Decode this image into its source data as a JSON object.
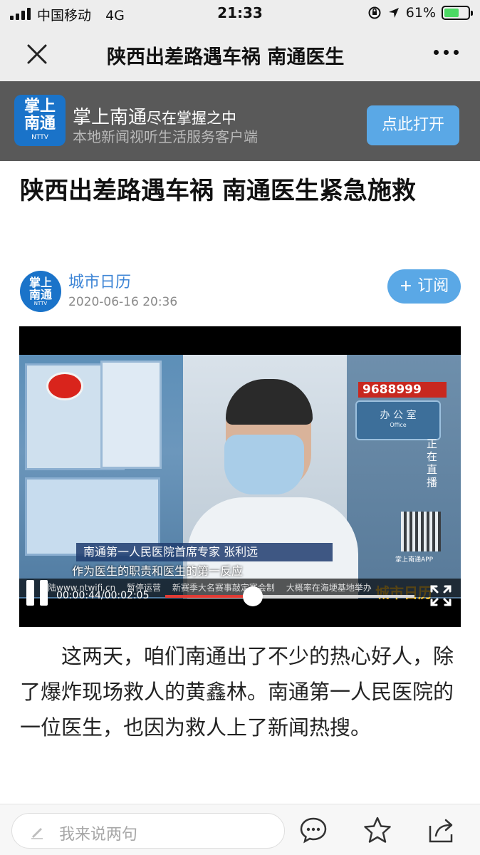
{
  "status_bar": {
    "carrier": "中国移动",
    "network": "4G",
    "time": "21:33",
    "battery_percent": "61%",
    "battery_level": 0.61
  },
  "nav": {
    "title": "陕西出差路遇车祸 南通医生"
  },
  "app_banner": {
    "logo_line1": "掌上",
    "logo_line2": "南通",
    "logo_mark": "NTTV",
    "name": "掌上南通",
    "slogan": "尽在掌握之中",
    "subtitle": "本地新闻视听生活服务客户端",
    "open_button": "点此打开"
  },
  "article": {
    "title": "陕西出差路遇车祸 南通医生紧急施救",
    "author": {
      "avatar_line1": "掌上",
      "avatar_line2": "南通",
      "avatar_mark": "NTTV",
      "name": "城市日历",
      "date": "2020-06-16 20:36"
    },
    "subscribe_button": "+ 订阅",
    "body": "这两天，咱们南通出了不少的热心好人，除了爆炸现场救人的黄鑫林。南通第一人民医院的一位医生，也因为救人上了新闻热搜。"
  },
  "video": {
    "hotline": "9688999",
    "office_sign": "办 公 室",
    "office_sign_en": "Office",
    "live_text": "正在直播",
    "qr_caption": "掌上南通APP",
    "city_logo": "城市日历",
    "lower_third": "南通第一人民医院首席专家  张利远",
    "subtitle": "作为医生的职责和医生的第一反应",
    "ticker": [
      "陆www.ntwifi.cn",
      "暂停运营",
      "新赛季大名赛事敲定赛会制",
      "大概率在海埂基地举办"
    ],
    "current_time": "00:00:44",
    "duration": "00:02:05",
    "time_display": "00:00:44/00:02:05",
    "progress": 0.352
  },
  "bottom_bar": {
    "comment_placeholder": "我来说两句"
  },
  "icons": {
    "close": "close-icon",
    "more": "more-icon",
    "pause": "pause-icon",
    "fullscreen": "fullscreen-icon",
    "pen": "pen-icon",
    "comment": "comment-icon",
    "favorite": "star-icon",
    "share": "share-icon"
  },
  "colors": {
    "accent": "#5aa8e6",
    "link": "#3f86d6",
    "progress": "#e23b34",
    "banner_bg": "#595959"
  }
}
